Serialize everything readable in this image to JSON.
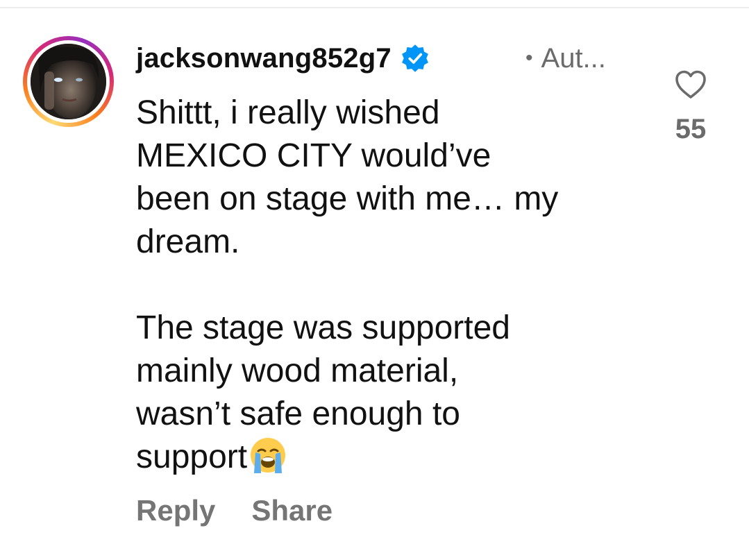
{
  "comment": {
    "username": "jacksonwang852g7",
    "verified_icon": "verified-badge-icon",
    "meta": "Aut...",
    "text": "Shittt, i really wished\nMEXICO CITY would’ve\nbeen on stage with me… my\ndream.\n\nThe stage was supported\nmainly wood material,\nwasn’t safe enough to\nsupport",
    "emoji": "loudly-crying-face-emoji",
    "like_count": "55",
    "reply_label": "Reply",
    "share_label": "Share"
  },
  "colors": {
    "text": "#111111",
    "secondary": "#6b6b6b",
    "verified": "#0095f6"
  }
}
